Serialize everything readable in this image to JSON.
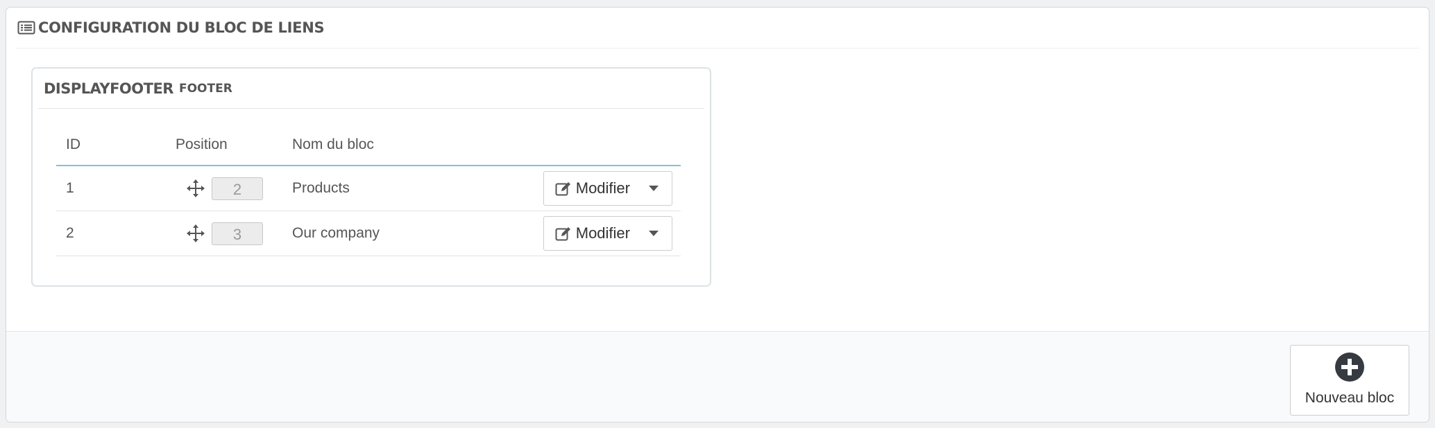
{
  "panel": {
    "title": "CONFIGURATION DU BLOC DE LIENS",
    "icon": "list-icon"
  },
  "hook": {
    "name": "DISPLAYFOOTER",
    "sub": "FOOTER"
  },
  "table": {
    "headers": {
      "id": "ID",
      "position": "Position",
      "name": "Nom du bloc"
    },
    "rows": [
      {
        "id": "1",
        "position": "2",
        "name": "Products",
        "action": "Modifier"
      },
      {
        "id": "2",
        "position": "3",
        "name": "Our company",
        "action": "Modifier"
      }
    ]
  },
  "footer": {
    "new_button": "Nouveau bloc"
  },
  "colors": {
    "accent_border": "#7cc3d8",
    "icon": "#363a41"
  }
}
